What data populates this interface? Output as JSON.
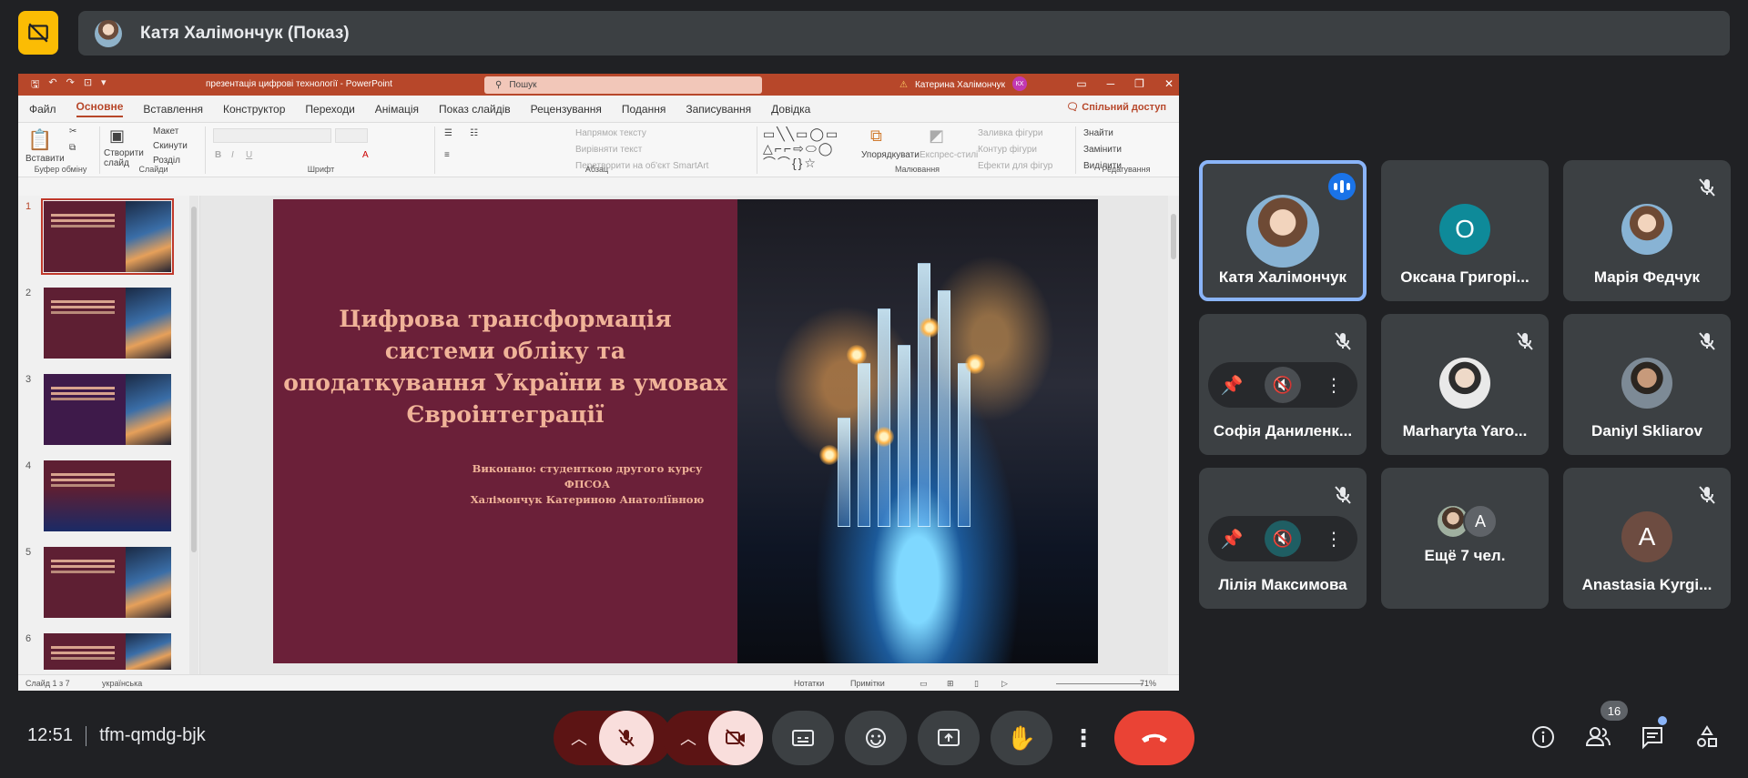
{
  "presenter": {
    "name": "Катя Халімончук (Показ)"
  },
  "powerpoint": {
    "title": "презентація цифрові технології  -  PowerPoint",
    "search_placeholder": "Пошук",
    "user_name": "Катерина Халімончук",
    "user_initials": "КХ",
    "share_label": "Спільний доступ",
    "tabs": [
      "Файл",
      "Основне",
      "Вставлення",
      "Конструктор",
      "Переходи",
      "Анімація",
      "Показ слайдів",
      "Рецензування",
      "Подання",
      "Записування",
      "Довідка"
    ],
    "active_tab": "Основне",
    "ribbon": {
      "paste": "Вставити",
      "clipboard_group": "Буфер обміну",
      "new_slide": "Створити слайд",
      "layout": "Макет",
      "reset": "Скинути",
      "sections": "Розділ",
      "slides_group": "Слайди",
      "font_group": "Шрифт",
      "text_direction": "Напрямок тексту",
      "align_text": "Вирівняти текст",
      "smartart": "Перетворити на об'єкт SmartArt",
      "paragraph_group": "Абзац",
      "arrange": "Упорядкувати",
      "quick_styles": "Експрес-стилі",
      "shape_fill": "Заливка фігури",
      "shape_outline": "Контур фігури",
      "shape_effects": "Ефекти для фігур",
      "drawing_group": "Малювання",
      "find": "Знайти",
      "replace": "Замінити",
      "select": "Виділити",
      "editing_group": "Редагування"
    },
    "slide_numbers": [
      "1",
      "2",
      "3",
      "4",
      "5",
      "6"
    ],
    "slide": {
      "title": "Цифрова трансформація системи обліку та оподаткування України в умовах Євроінтеграції",
      "author_line1": "Виконано: студенткою другого курсу ФПСОА",
      "author_line2": "Халімончук  Катериною Анатоліївною"
    },
    "status": {
      "slide_counter": "Слайд 1 з 7",
      "language": "українська",
      "notes": "Нотатки",
      "comments": "Примітки",
      "zoom": "71%"
    }
  },
  "participants": [
    {
      "name": "Катя Халімончук",
      "avatar": "photo",
      "speaking": true
    },
    {
      "name": "Оксана Григорі...",
      "initial": "О",
      "avatar_color": "#0e8a99"
    },
    {
      "name": "Марія Федчук",
      "avatar": "photo",
      "muted": true
    },
    {
      "name": "Софія Даниленк...",
      "muted": true,
      "hover_controls": true
    },
    {
      "name": "Marharyta Yaro...",
      "avatar": "photo",
      "muted": true
    },
    {
      "name": "Daniyl Skliarov",
      "avatar": "photo",
      "muted": true
    },
    {
      "name": "Лілія Максимова",
      "muted": true,
      "hover_controls": true
    },
    {
      "name": "Ещё 7 чел.",
      "more_initial": "A"
    },
    {
      "name": "Anastasia Kyrgi...",
      "initial": "A",
      "muted": true
    }
  ],
  "meeting": {
    "time": "12:51",
    "code": "tfm-qmdg-bjk",
    "participant_count": "16"
  },
  "colors": {
    "accent": "#8ab4f8",
    "end_call": "#ea4335",
    "ppt_brand": "#b7472a",
    "slide_bg": "#6b2039",
    "slide_text": "#f0b398"
  }
}
